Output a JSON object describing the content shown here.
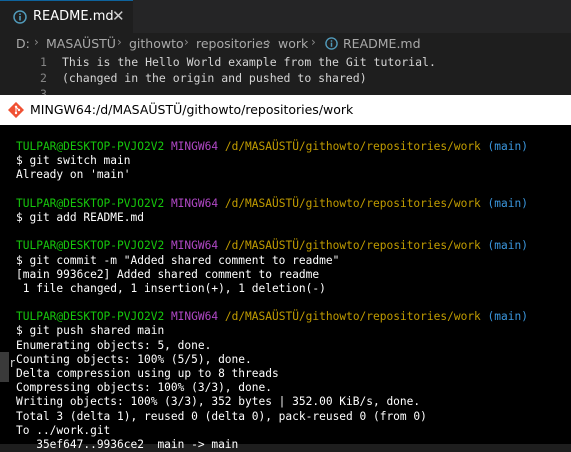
{
  "editor": {
    "tab": {
      "filename": "README.md",
      "close_glyph": "✕"
    },
    "breadcrumb": [
      "D:",
      "MASAÜSTÜ",
      "githowto",
      "repositories",
      "work",
      "README.md"
    ],
    "breadcrumb_separator": "›",
    "lines": [
      {
        "num": "1",
        "text": "This is the Hello World example from the Git tutorial."
      },
      {
        "num": "2",
        "text": "(changed in the origin and pushed to shared)"
      },
      {
        "num": "3",
        "text": ""
      }
    ]
  },
  "terminal": {
    "title": "MINGW64:/d/MASAÜSTÜ/githowto/repositories/work",
    "side_letter": "r",
    "prompt": {
      "user": "TULPAR@DESKTOP-PVJO2V2",
      "env": "MINGW64",
      "path": "/d/MASAÜSTÜ/githowto/repositories/work",
      "branch": "(main)"
    },
    "lines": [
      {
        "type": "prompt"
      },
      {
        "type": "text",
        "text": "$ git switch main"
      },
      {
        "type": "text",
        "text": "Already on 'main'"
      },
      {
        "type": "text",
        "text": ""
      },
      {
        "type": "prompt"
      },
      {
        "type": "text",
        "text": "$ git add README.md"
      },
      {
        "type": "text",
        "text": ""
      },
      {
        "type": "prompt"
      },
      {
        "type": "text",
        "text": "$ git commit -m \"Added shared comment to readme\""
      },
      {
        "type": "text",
        "text": "[main 9936ce2] Added shared comment to readme"
      },
      {
        "type": "text",
        "text": " 1 file changed, 1 insertion(+), 1 deletion(-)"
      },
      {
        "type": "text",
        "text": ""
      },
      {
        "type": "prompt"
      },
      {
        "type": "text",
        "text": "$ git push shared main"
      },
      {
        "type": "text",
        "text": "Enumerating objects: 5, done."
      },
      {
        "type": "text",
        "text": "Counting objects: 100% (5/5), done."
      },
      {
        "type": "text",
        "text": "Delta compression using up to 8 threads"
      },
      {
        "type": "text",
        "text": "Compressing objects: 100% (3/3), done."
      },
      {
        "type": "text",
        "text": "Writing objects: 100% (3/3), 352 bytes | 352.00 KiB/s, done."
      },
      {
        "type": "text",
        "text": "Total 3 (delta 1), reused 0 (delta 0), pack-reused 0 (from 0)"
      },
      {
        "type": "text",
        "text": "To ../work.git"
      },
      {
        "type": "text",
        "text": "   35ef647..9936ce2  main -> main"
      }
    ]
  },
  "colors": {
    "prompt_user": "#16c60c",
    "prompt_env": "#b148c6",
    "prompt_path": "#c19c00",
    "prompt_branch": "#3a96dd"
  }
}
